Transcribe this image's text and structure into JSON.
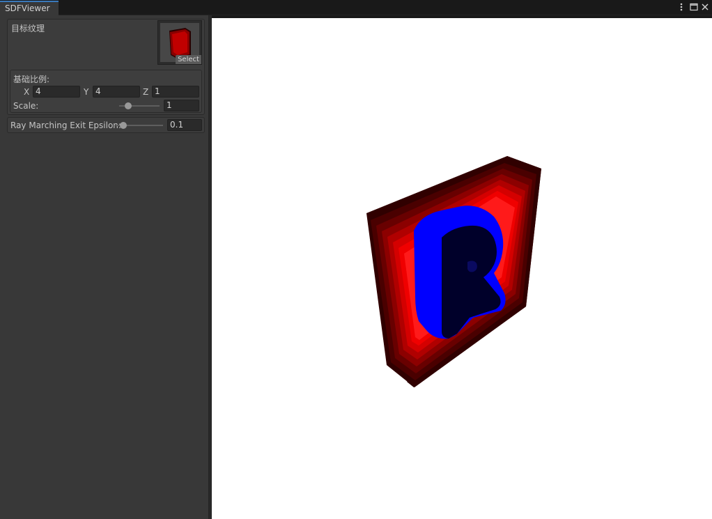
{
  "window": {
    "tab_title": "SDFViewer",
    "menu_icon": "kebab-menu-icon",
    "maximize_icon": "maximize-icon",
    "close_icon": "close-icon"
  },
  "inspector": {
    "target_texture_label": "目标纹理",
    "select_label": "Select",
    "base_scale": {
      "title": "基础比例:",
      "x_label": "X",
      "x_value": "4",
      "y_label": "Y",
      "y_value": "4",
      "z_label": "Z",
      "z_value": "1",
      "scale_label": "Scale:",
      "scale_value": "1",
      "scale_slider_level": 0.22
    },
    "epsilon": {
      "label": "Ray Marching Exit Epsilon:",
      "value": "0.1",
      "slider_level": 0.15
    }
  },
  "colors": {
    "accent": "#3a79bb",
    "panel_bg": "#383838",
    "viewport_bg": "#ffffff",
    "sdf_outer": "#ff0000",
    "sdf_letter": "#0000ff"
  }
}
